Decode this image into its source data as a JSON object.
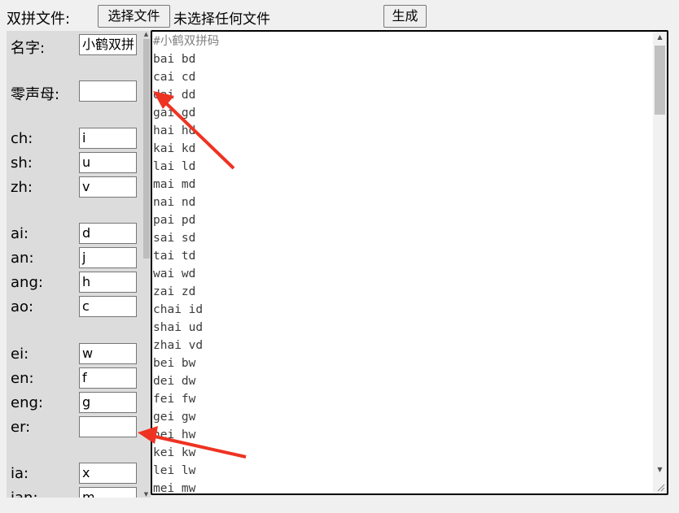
{
  "toolbar": {
    "file_label": "双拼文件:",
    "choose_file_button": "选择文件",
    "file_status": "未选择任何文件",
    "generate_button": "生成"
  },
  "settings": {
    "name": {
      "label": "名字:",
      "value": "小鹤双拼"
    },
    "zero_initial": {
      "label": "零声母:",
      "value": ""
    },
    "rows": [
      {
        "label": "ch:",
        "value": "i"
      },
      {
        "label": "sh:",
        "value": "u"
      },
      {
        "label": "zh:",
        "value": "v"
      },
      {
        "label": "ai:",
        "value": "d"
      },
      {
        "label": "an:",
        "value": "j"
      },
      {
        "label": "ang:",
        "value": "h"
      },
      {
        "label": "ao:",
        "value": "c"
      },
      {
        "label": "ei:",
        "value": "w"
      },
      {
        "label": "en:",
        "value": "f"
      },
      {
        "label": "eng:",
        "value": "g"
      },
      {
        "label": "er:",
        "value": ""
      },
      {
        "label": "ia:",
        "value": "x"
      },
      {
        "label": "ian:",
        "value": "m"
      }
    ]
  },
  "output": {
    "lines": [
      "#小鹤双拼码",
      "bai bd",
      "cai cd",
      "dai dd",
      "gai gd",
      "hai hd",
      "kai kd",
      "lai ld",
      "mai md",
      "nai nd",
      "pai pd",
      "sai sd",
      "tai td",
      "wai wd",
      "zai zd",
      "chai id",
      "shai ud",
      "zhai vd",
      "bei bw",
      "dei dw",
      "fei fw",
      "gei gw",
      "hei hw",
      "kei kw",
      "lei lw",
      "mei mw"
    ]
  },
  "colors": {
    "annotation_arrow": "#ee3322"
  }
}
